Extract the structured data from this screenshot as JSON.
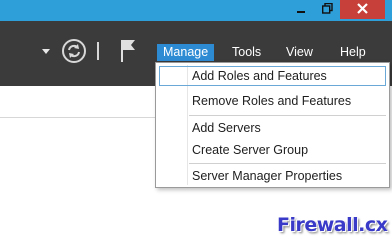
{
  "window": {
    "controls": [
      {
        "name": "minimize-icon"
      },
      {
        "name": "restore-icon"
      },
      {
        "name": "close-icon"
      }
    ]
  },
  "toolbar": {
    "icons": [
      "dropdown-arrow-icon",
      "refresh-icon",
      "flag-icon"
    ]
  },
  "menu": {
    "items": [
      {
        "label": "Manage",
        "active": true
      },
      {
        "label": "Tools"
      },
      {
        "label": "View"
      },
      {
        "label": "Help"
      }
    ]
  },
  "manage_menu": {
    "items": [
      {
        "label": "Add Roles and Features",
        "highlighted": true
      },
      {
        "label": "Remove Roles and Features"
      },
      {
        "label": "Add Servers"
      },
      {
        "label": "Create Server Group"
      },
      {
        "label": "Server Manager Properties"
      }
    ]
  },
  "watermark": {
    "text": "Firewall.cx"
  },
  "colors": {
    "titlebar": "#2e9fd9",
    "close": "#c7403a",
    "toolbar": "#3b3b3b",
    "menu_active": "#2d8bd4",
    "highlight_border": "#6aa8d8"
  }
}
